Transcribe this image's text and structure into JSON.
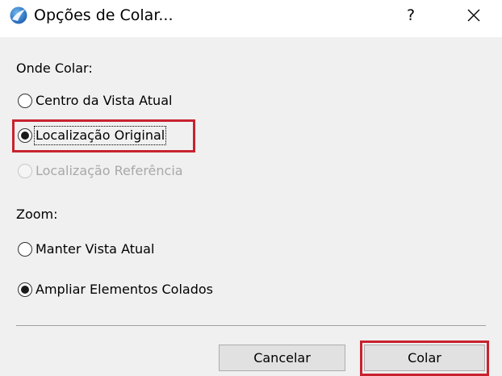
{
  "window": {
    "title": "Opções de Colar...",
    "help_label": "?",
    "app_icon": "archicad-logo-icon",
    "close_icon": "close-icon"
  },
  "colors": {
    "highlight": "#c8222f",
    "client_bg": "#f0f0f0"
  },
  "where_group": {
    "label": "Onde Colar:",
    "options": [
      {
        "label": "Centro da Vista Atual",
        "selected": false,
        "enabled": true
      },
      {
        "label": "Localização Original",
        "selected": true,
        "enabled": true
      },
      {
        "label": "Localização Referência",
        "selected": false,
        "enabled": false
      }
    ]
  },
  "zoom_group": {
    "label": "Zoom:",
    "options": [
      {
        "label": "Manter Vista Atual",
        "selected": false,
        "enabled": true
      },
      {
        "label": "Ampliar Elementos Colados",
        "selected": true,
        "enabled": true
      }
    ]
  },
  "buttons": {
    "cancel_label": "Cancelar",
    "paste_label": "Colar"
  }
}
